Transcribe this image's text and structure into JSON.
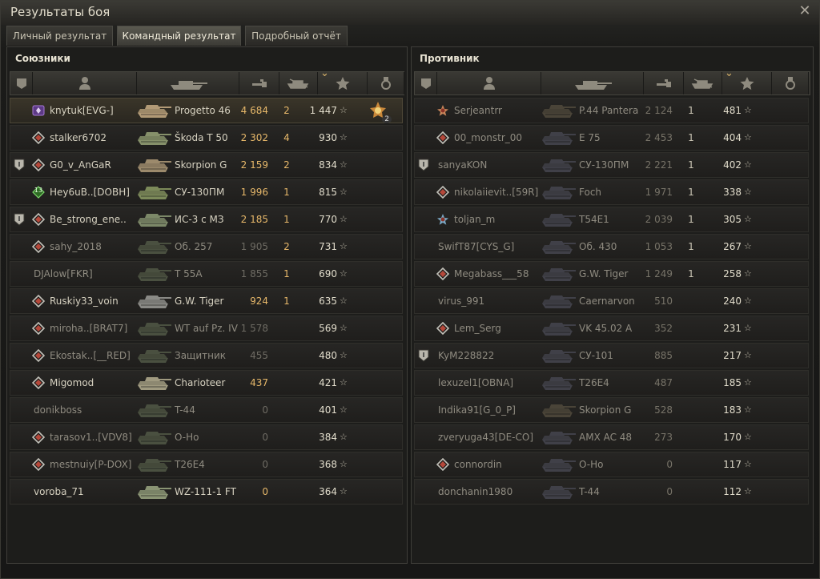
{
  "window": {
    "title": "Результаты боя",
    "close_icon": "close-icon"
  },
  "tabs": [
    {
      "label": "Личный результат",
      "active": false
    },
    {
      "label": "Командный результат",
      "active": true
    },
    {
      "label": "Подробный отчёт",
      "active": false
    }
  ],
  "allies": {
    "title": "Союзники",
    "columns": [
      "squad-icon",
      "player-icon",
      "tank-icon",
      "damage-icon",
      "kills-icon",
      "xp-star-icon",
      "medal-icon"
    ],
    "sorted_column": "xp-star-icon",
    "rows": [
      {
        "badge": "",
        "rank": "purple",
        "player": "knytuk[EVG-]",
        "tank": "Progetto 46",
        "tank_color": "#b29a76",
        "dmg": "4 684",
        "dmg_style": "hi",
        "kills": "2",
        "xp": "1 447",
        "me": true,
        "medal": "2",
        "alive": true
      },
      {
        "badge": "",
        "rank": "silver",
        "player": "stalker6702",
        "tank": "Škoda T 50",
        "tank_color": "#86906a",
        "dmg": "2 302",
        "dmg_style": "hi",
        "kills": "4",
        "xp": "930",
        "alive": true
      },
      {
        "badge": "shield",
        "rank": "silver",
        "player": "G0_v_AnGaR",
        "tank": "Skorpion G",
        "tank_color": "#9c8a6c",
        "dmg": "2 159",
        "dmg_style": "hi",
        "kills": "2",
        "xp": "834",
        "alive": true
      },
      {
        "badge": "",
        "rank": "green",
        "rank_num": "13",
        "player": "Hey6uB..[DOBH]",
        "tank": "СУ-130ПМ",
        "tank_color": "#7c8a5a",
        "dmg": "1 996",
        "dmg_style": "hi",
        "kills": "1",
        "xp": "815",
        "alive": true
      },
      {
        "badge": "shield",
        "rank": "silver",
        "player": "Be_strong_ene..",
        "tank": "ИС-3 с МЗ",
        "tank_color": "#7c8868",
        "dmg": "2 185",
        "dmg_style": "hi",
        "kills": "1",
        "xp": "770",
        "alive": true
      },
      {
        "badge": "",
        "rank": "silver",
        "player": "sahy_2018",
        "tank": "Об. 257",
        "tank_color": "#4a5040",
        "dmg": "1 905",
        "dmg_style": "lo",
        "kills": "2",
        "xp": "731",
        "alive": false
      },
      {
        "badge": "",
        "rank": "",
        "player": "DJAlow[FKR]",
        "tank": "T 55A",
        "tank_color": "#4a5040",
        "dmg": "1 855",
        "dmg_style": "lo",
        "kills": "1",
        "xp": "690",
        "alive": false
      },
      {
        "badge": "",
        "rank": "silver",
        "player": "Ruskiy33_voin",
        "tank": "G.W. Tiger",
        "tank_color": "#8a8a86",
        "dmg": "924",
        "dmg_style": "hi",
        "kills": "1",
        "xp": "635",
        "alive": true
      },
      {
        "badge": "",
        "rank": "silver",
        "player": "miroha..[BRAT7]",
        "tank": "WT auf Pz. IV",
        "tank_color": "#4a5040",
        "dmg": "1 578",
        "dmg_style": "lo",
        "kills": "",
        "xp": "569",
        "alive": false
      },
      {
        "badge": "",
        "rank": "silver",
        "player": "Ekostak..[__RED]",
        "tank": "Защитник",
        "tank_color": "#4a5040",
        "dmg": "455",
        "dmg_style": "lo",
        "kills": "",
        "xp": "480",
        "alive": false
      },
      {
        "badge": "",
        "rank": "silver",
        "player": "Migomod",
        "tank": "Charioteer",
        "tank_color": "#a09a80",
        "dmg": "437",
        "dmg_style": "hi",
        "kills": "",
        "xp": "421",
        "alive": true
      },
      {
        "badge": "",
        "rank": "",
        "player": "donikboss",
        "tank": "T-44",
        "tank_color": "#4a5040",
        "dmg": "0",
        "dmg_style": "lo",
        "kills": "",
        "xp": "401",
        "alive": false
      },
      {
        "badge": "",
        "rank": "silver",
        "player": "tarasov1..[VDV8]",
        "tank": "O-Ho",
        "tank_color": "#4a5040",
        "dmg": "0",
        "dmg_style": "lo",
        "kills": "",
        "xp": "384",
        "alive": false
      },
      {
        "badge": "",
        "rank": "silver",
        "player": "mestnuiy[P-DOX]",
        "tank": "T26E4",
        "tank_color": "#4a5040",
        "dmg": "0",
        "dmg_style": "lo",
        "kills": "",
        "xp": "368",
        "alive": false
      },
      {
        "badge": "",
        "rank": "",
        "player": "voroba_71",
        "tank": "WZ-111-1 FT",
        "tank_color": "#8a9474",
        "dmg": "0",
        "dmg_style": "hi",
        "kills": "",
        "xp": "364",
        "alive": true
      }
    ]
  },
  "enemies": {
    "title": "Противник",
    "columns": [
      "squad-icon",
      "player-icon",
      "tank-icon",
      "damage-icon",
      "kills-icon",
      "xp-star-icon",
      "medal-icon"
    ],
    "sorted_column": "xp-star-icon",
    "rows": [
      {
        "badge": "",
        "rank": "bronze",
        "player": "Serjeantrr",
        "tank": "P.44 Pantera",
        "tank_color": "#4a4438",
        "dmg": "2 124",
        "kills": "1",
        "xp": "481",
        "alive": false
      },
      {
        "badge": "",
        "rank": "silver",
        "player": "00_monstr_00",
        "tank": "E 75",
        "tank_color": "#404048",
        "dmg": "2 453",
        "kills": "1",
        "xp": "404",
        "alive": false
      },
      {
        "badge": "shield",
        "rank": "",
        "player": "sanyaKON",
        "tank": "СУ-130ПМ",
        "tank_color": "#404048",
        "dmg": "2 221",
        "kills": "1",
        "xp": "402",
        "alive": false
      },
      {
        "badge": "",
        "rank": "silver",
        "player": "nikolaiievit..[59R]",
        "tank": "Foch",
        "tank_color": "#404048",
        "dmg": "1 971",
        "kills": "1",
        "xp": "338",
        "alive": false
      },
      {
        "badge": "",
        "rank": "steel",
        "player": "toljan_m",
        "tank": "T54E1",
        "tank_color": "#404048",
        "dmg": "2 039",
        "kills": "1",
        "xp": "305",
        "alive": false
      },
      {
        "badge": "",
        "rank": "",
        "player": "SwifT87[CYS_G]",
        "tank": "Об. 430",
        "tank_color": "#404048",
        "dmg": "1 053",
        "kills": "1",
        "xp": "267",
        "alive": false
      },
      {
        "badge": "",
        "rank": "silver",
        "player": "Megabass___58",
        "tank": "G.W. Tiger",
        "tank_color": "#404048",
        "dmg": "1 249",
        "kills": "1",
        "xp": "258",
        "alive": false
      },
      {
        "badge": "",
        "rank": "",
        "player": "virus_991",
        "tank": "Caernarvon",
        "tank_color": "#404048",
        "dmg": "510",
        "kills": "",
        "xp": "240",
        "alive": false
      },
      {
        "badge": "",
        "rank": "silver",
        "player": "Lem_Serg",
        "tank": "VK 45.02 A",
        "tank_color": "#404048",
        "dmg": "352",
        "kills": "",
        "xp": "231",
        "alive": false
      },
      {
        "badge": "shield",
        "rank": "",
        "player": "KyM228822",
        "tank": "СУ-101",
        "tank_color": "#404048",
        "dmg": "885",
        "kills": "",
        "xp": "217",
        "alive": false
      },
      {
        "badge": "",
        "rank": "",
        "player": "lexuzel1[OBNA]",
        "tank": "T26E4",
        "tank_color": "#404048",
        "dmg": "487",
        "kills": "",
        "xp": "185",
        "alive": false
      },
      {
        "badge": "",
        "rank": "",
        "player": "Indika91[G_0_P]",
        "tank": "Skorpion G",
        "tank_color": "#4a4438",
        "dmg": "528",
        "kills": "",
        "xp": "183",
        "alive": false
      },
      {
        "badge": "",
        "rank": "",
        "player": "zveryuga43[DE-CO]",
        "tank": "AMX AC 48",
        "tank_color": "#404048",
        "dmg": "273",
        "kills": "",
        "xp": "170",
        "alive": false
      },
      {
        "badge": "",
        "rank": "silver",
        "player": "connordin",
        "tank": "O-Ho",
        "tank_color": "#404048",
        "dmg": "0",
        "kills": "",
        "xp": "117",
        "alive": false
      },
      {
        "badge": "",
        "rank": "",
        "player": "donchanin1980",
        "tank": "T-44",
        "tank_color": "#404048",
        "dmg": "0",
        "kills": "",
        "xp": "112",
        "alive": false
      }
    ]
  }
}
